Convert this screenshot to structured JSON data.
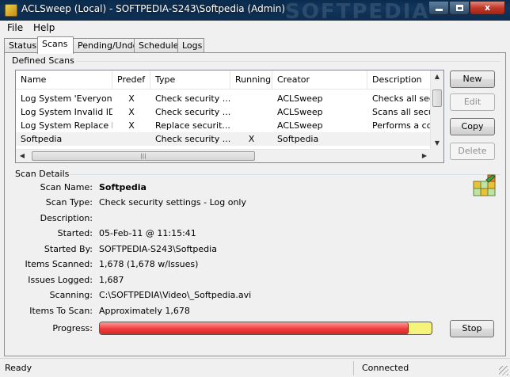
{
  "window": {
    "title": "ACLSweep (Local) - SOFTPEDIA-S243\\Softpedia (Admin)",
    "watermark": "SOFTPEDIA",
    "minimize_icon": "minimize-icon",
    "maximize_icon": "maximize-icon",
    "close_glyph": "x"
  },
  "menu": {
    "items": [
      "File",
      "Help"
    ]
  },
  "tabs": [
    {
      "label": "Status"
    },
    {
      "label": "Scans"
    },
    {
      "label": "Pending/Undo"
    },
    {
      "label": "Schedule"
    },
    {
      "label": "Logs"
    }
  ],
  "active_tab": "Scans",
  "defined_scans": {
    "label": "Defined Scans",
    "columns": [
      "Name",
      "Predef",
      "Type",
      "Running",
      "Creator",
      "Description"
    ],
    "rows": [
      {
        "name": "Log System 'Everyon...",
        "predef": "X",
        "type": "Check security ...",
        "running": "",
        "creator": "ACLSweep",
        "description": "Checks all secu"
      },
      {
        "name": "Log System Invalid ID",
        "predef": "X",
        "type": "Check security ...",
        "running": "",
        "creator": "ACLSweep",
        "description": "Scans all secur"
      },
      {
        "name": "Log System Replace ID",
        "predef": "X",
        "type": "Replace securit...",
        "running": "",
        "creator": "ACLSweep",
        "description": "Performs a con"
      },
      {
        "name": "Softpedia",
        "predef": "",
        "type": "Check security ...",
        "running": "X",
        "creator": "Softpedia",
        "description": ""
      }
    ],
    "selected_row": 3,
    "buttons": {
      "new": "New",
      "edit": "Edit",
      "copy": "Copy",
      "delete": "Delete"
    }
  },
  "scan_details": {
    "label": "Scan Details",
    "fields": [
      {
        "label": "Scan Name:",
        "value": "Softpedia"
      },
      {
        "label": "Scan Type:",
        "value": "Check security settings - Log only"
      },
      {
        "label": "Description:",
        "value": ""
      },
      {
        "label": "Started:",
        "value": "05-Feb-11 @ 11:15:41"
      },
      {
        "label": "Started By:",
        "value": "SOFTPEDIA-S243\\Softpedia"
      },
      {
        "label": "Items Scanned:",
        "value": "1,678  (1,678 w/Issues)"
      },
      {
        "label": "Issues Logged:",
        "value": "1,687"
      },
      {
        "label": "Scanning:",
        "value": "C:\\SOFTPEDIA\\Video\\_Softpedia.avi"
      },
      {
        "label": "Items To Scan:",
        "value": "Approximately 1,678"
      }
    ],
    "progress_label": "Progress:",
    "progress_percent": 93,
    "stop_label": "Stop",
    "icon": "aclsweep-logo-icon"
  },
  "statusbar": {
    "left": "Ready",
    "right": "Connected"
  },
  "colors": {
    "titlebar": "#0d2c4f",
    "progress_fill": "#ee3b3b",
    "progress_track": "#f5f37a"
  }
}
